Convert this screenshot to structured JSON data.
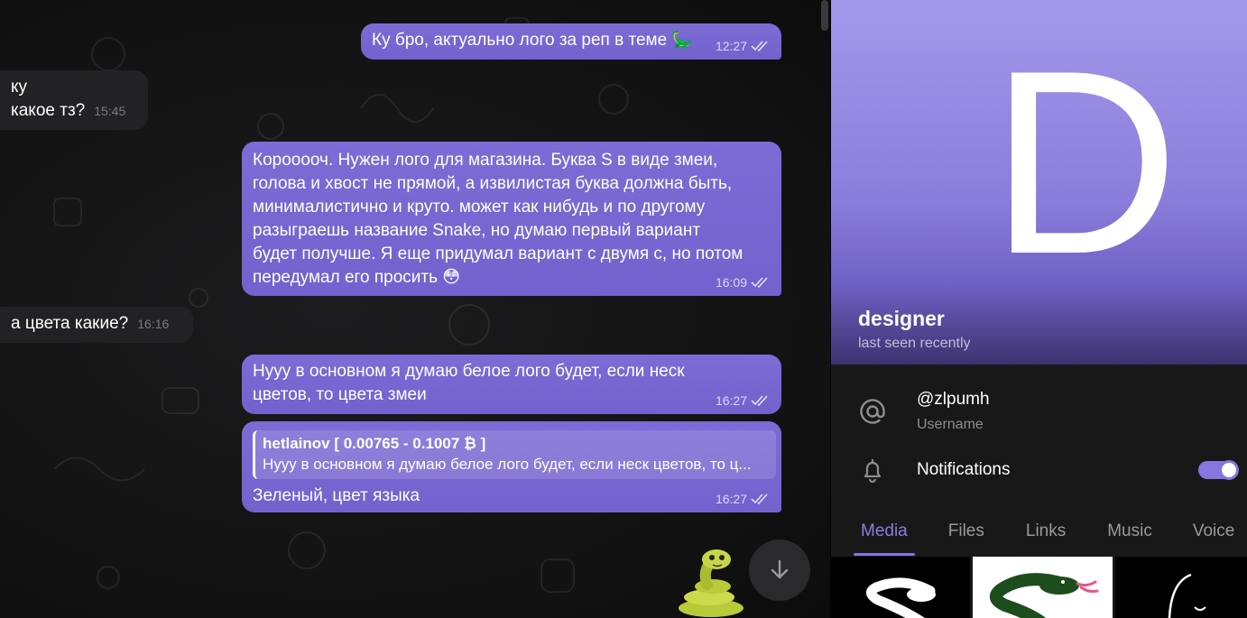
{
  "chat": {
    "messages": [
      {
        "side": "out",
        "text": "Ку бро, актуально лого за реп в теме 🦕",
        "time": "12:27"
      },
      {
        "side": "in",
        "lines": [
          "ку",
          "какое тз?"
        ],
        "time": "15:45"
      },
      {
        "side": "out",
        "lines": [
          "Корооооч. Нужен лого для магазина. Буква S в виде змеи,",
          "голова и хвост не прямой, а извилистая буква должна быть,",
          "минималистично и круто. может как нибудь и по другому",
          "разыграешь название Snake, но думаю первый вариант",
          "будет получше. Я еще придумал вариант с двумя с, но потом",
          "передумал его просить 😳"
        ],
        "time": "16:09"
      },
      {
        "side": "in",
        "text": "а цвета какие?",
        "time": "16:16"
      },
      {
        "side": "out",
        "lines": [
          "Нууу в основном я думаю белое лого будет, если неск",
          "цветов, то цвета змеи"
        ],
        "time": "16:27"
      },
      {
        "side": "out",
        "reply_name": "hetlainov [ 0.00765 - 0.1007 ₿ ]",
        "reply_text": "Нууу в основном я думаю белое лого будет, если неск цветов, то ц...",
        "text": "Зеленый, цвет языка",
        "time": "16:27"
      }
    ]
  },
  "profile": {
    "avatar_letter": "D",
    "name": "designer",
    "status": "last seen recently",
    "username": "@zlpumh",
    "username_label": "Username",
    "notifications_label": "Notifications",
    "notifications_on": true,
    "tabs": [
      "Media",
      "Files",
      "Links",
      "Music",
      "Voice"
    ],
    "active_tab": "Media"
  },
  "colors": {
    "accent": "#8676dd",
    "outgoing_bubble": "#7a68d4",
    "incoming_bubble": "#222224",
    "panel_bg": "#181818"
  },
  "icons": [
    "double-check-icon",
    "at-icon",
    "bell-icon",
    "arrow-down-icon",
    "snake-sticker"
  ]
}
